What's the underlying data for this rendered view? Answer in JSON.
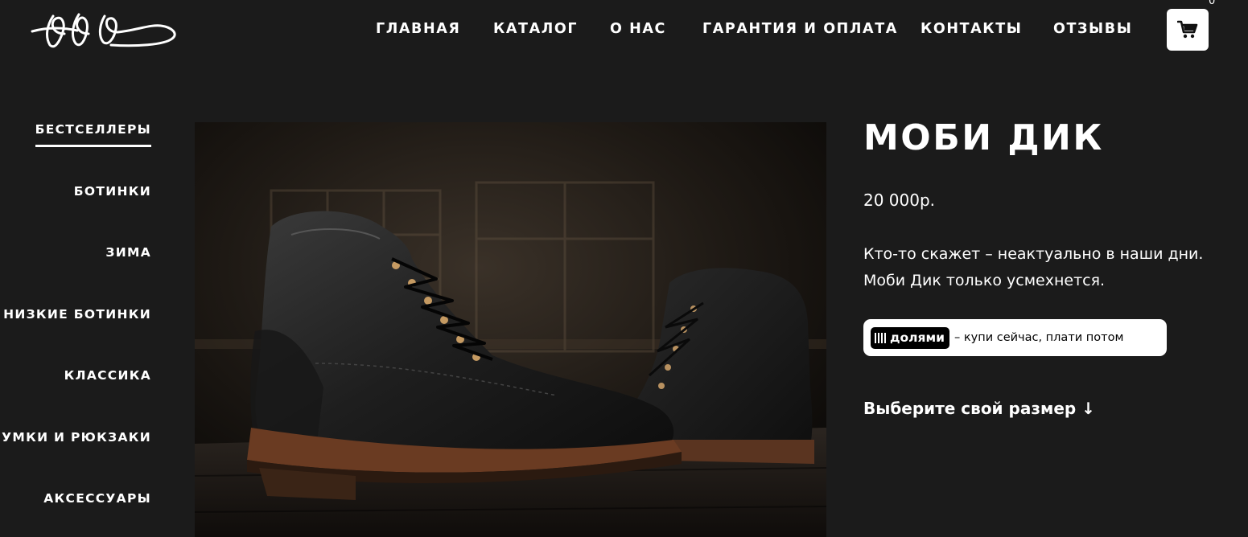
{
  "header": {
    "logo_icon": "signature-logo",
    "nav": [
      {
        "label": "ГЛАВНАЯ"
      },
      {
        "label": "КАТАЛОГ"
      },
      {
        "label": "О НАС"
      },
      {
        "label": "ГАРАНТИЯ И ОПЛАТА"
      },
      {
        "label": "КОНТАКТЫ"
      },
      {
        "label": "ОТЗЫВЫ"
      }
    ],
    "cart_icon": "cart-icon",
    "cart_count": "0"
  },
  "sidebar": {
    "items": [
      {
        "label": "БЕСТСЕЛЛЕРЫ",
        "active": true
      },
      {
        "label": "БОТИНКИ"
      },
      {
        "label": "ЗИМА"
      },
      {
        "label": "НИЗКИЕ БОТИНКИ"
      },
      {
        "label": "КЛАССИКА"
      },
      {
        "label": "СУМКИ И РЮКЗАКИ"
      },
      {
        "label": "АКСЕССУАРЫ"
      }
    ]
  },
  "product": {
    "title": "МОБИ ДИК",
    "price": "20 000р.",
    "description_line1": "Кто-то скажет – неактуально в наши дни.",
    "description_line2": "Моби Дик только усмехнется.",
    "installment": {
      "badge": "долями",
      "text": "– купи сейчас, плати потом"
    },
    "size_prompt": "Выберите свой размер ↓",
    "image_icon": "black-leather-boots-photo"
  },
  "colors": {
    "background": "#1b1b1b",
    "text": "#ffffff",
    "badge_bg": "#000000",
    "cart_bg": "#ffffff"
  }
}
